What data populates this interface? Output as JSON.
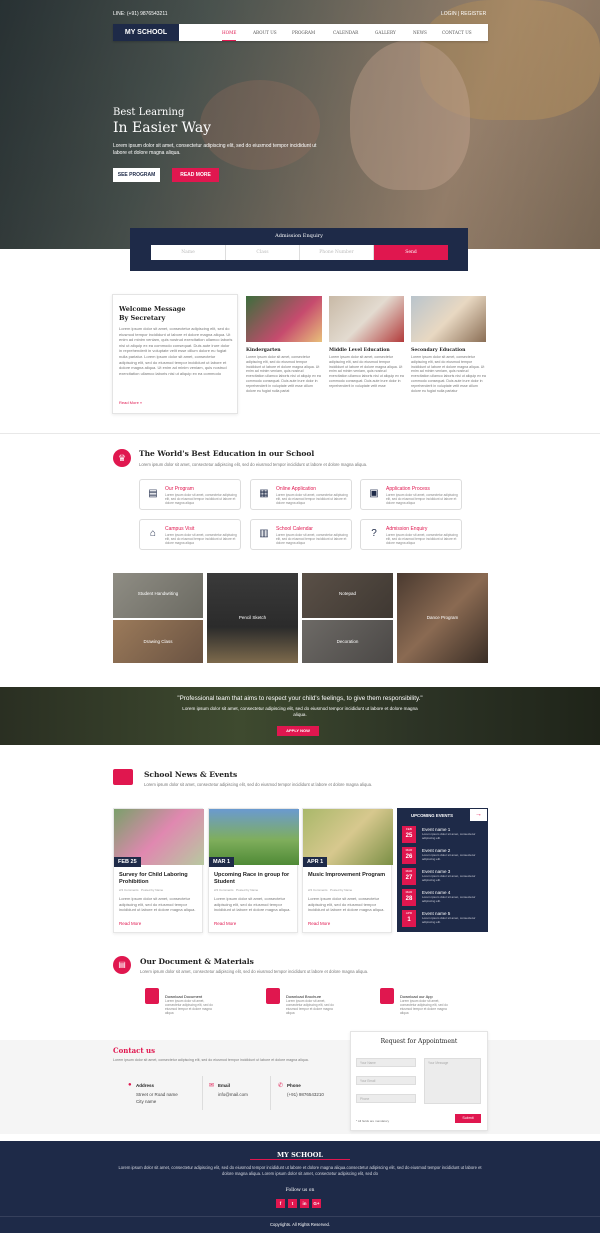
{
  "topbar": {
    "phone": "LINE: (+91) 9876543211",
    "auth": "LOGIN | REGISTER"
  },
  "nav": {
    "logo": "MY SCHOOL",
    "items": [
      "HOME",
      "ABOUT US",
      "PROGRAM",
      "CALENDAR",
      "GALLERY",
      "NEWS",
      "CONTACT US"
    ],
    "active": "HOME"
  },
  "hero": {
    "line1": "Best Learning",
    "line2": "In Easier Way",
    "text": "Lorem ipsum dolor sit amet, consectetur adipiscing elit, sed do eiusmod tempor incididunt ut labore et dolore magna aliqua.",
    "btn1": "SEE PROGRAM",
    "btn2": "READ MORE"
  },
  "enquiry": {
    "title": "Admission Enquiry",
    "name": "Name",
    "class": "Class",
    "phone": "Phone Number",
    "send": "Send"
  },
  "welcome": {
    "title1": "Welcome Message",
    "title2": "By Secretary",
    "text": "Lorem ipsum dolor sit amet, consectetur adipiscing elit, sed do eiusmod tempor incididunt ut labore et dolore magna aliqua. Ut enim ad minim veniam, quis nostrud exercitation ullamco laboris nisi ut aliquip ex ea commodo consequat. Duis aute irure dolor in reprehenderit in voluptate velit esse cillum dolore eu fugiat nulla pariatur. Lorem ipsum dolor sit amet, consectetur adipiscing elit, sed do eiusmod tempor incididunt ut labore et dolore magna aliqua. Ut enim ad minim veniam, quis nostrud exercitation ullamco laboris nisi ut aliquip ex ea commodo",
    "link": "Read More »"
  },
  "levels": [
    {
      "title": "Kindergarten",
      "text": "Lorem ipsum dolor sit amet, consectetur adipiscing elit, sed do eiusmod tempor incididunt ut labore et dolore magna aliqua. Ut enim ad minim veniam, quis nostrud exercitation ullamco laboris nisi ut aliquip ex ea commodo consequat. Duis aute irure dolor in reprehenderit in voluptate velit esse cillum dolore eu fugiat nulla pariat"
    },
    {
      "title": "Middle Level Education",
      "text": "Lorem ipsum dolor sit amet, consectetur adipiscing elit, sed do eiusmod tempor incididunt ut labore et dolore magna aliqua. Ut enim ad minim veniam, quis nostrud exercitation ullamco laboris nisi ut aliquip ex ea commodo consequat. Duis aute irure dolor in reprehenderit in voluptate velit esse"
    },
    {
      "title": "Secondary Education",
      "text": "Lorem ipsum dolor sit amet, consectetur adipiscing elit, sed do eiusmod tempor incididunt ut labore et dolore magna aliqua. Ut enim ad minim veniam, quis nostrud exercitation ullamco laboris nisi ut aliquip ex ea commodo consequat. Duis aute irure dolor in reprehenderit in voluptate velit esse cillum dolore eu fugiat nulla pariatur"
    }
  ],
  "world": {
    "title": "The World's Best Education in our School",
    "text": "Lorem ipsum dolor sit amet, consectetur adipiscing elit, sed do eiusmod tempor incididunt ut labore et dolore magna aliqua."
  },
  "features": [
    {
      "title": "Our Program",
      "text": "Lorem ipsum dolor sit amet, consectetur adipiscing elit, sed do eiusmod tempor incididunt ut labore et dolore magna aliqua"
    },
    {
      "title": "Online Application",
      "text": "Lorem ipsum dolor sit amet, consectetur adipiscing elit, sed do eiusmod tempor incididunt ut labore et dolore magna aliqua"
    },
    {
      "title": "Application Process",
      "text": "Lorem ipsum dolor sit amet, consectetur adipiscing elit, sed do eiusmod tempor incididunt ut labore et dolore magna aliqua"
    },
    {
      "title": "Campus Visit",
      "text": "Lorem ipsum dolor sit amet, consectetur adipiscing elit, sed do eiusmod tempor incididunt ut labore et dolore magna aliqua"
    },
    {
      "title": "School Calendar",
      "text": "Lorem ipsum dolor sit amet, consectetur adipiscing elit, sed do eiusmod tempor incididunt ut labore et dolore magna aliqua"
    },
    {
      "title": "Admission Enquiry",
      "text": "Lorem ipsum dolor sit amet, consectetur adipiscing elit, sed do eiusmod tempor incididunt ut labore et dolore magna aliqua"
    }
  ],
  "gallery": [
    "Student Handwriting",
    "Drawing Class",
    "Pencil Sketch",
    "Notepad",
    "Decoration",
    "Dance Program"
  ],
  "quote": {
    "text": "\"Professional team that aims to respect your child's feelings, to give them responsibility.\"",
    "sub": "Lorem ipsum dolor sit amet, consectetur adipiscing elit, sed do eiusmod tempor incididunt ut labore et dolore magna aliqua.",
    "btn": "APPLY NOW"
  },
  "newsSection": {
    "title": "School News & Events",
    "text": "Lorem ipsum dolor sit amet, consectetur adipiscing elit, sed do eiusmod tempor incididunt ut labore et dolore magna aliqua."
  },
  "news": [
    {
      "date": "FEB 25",
      "title": "Survey for Child Laboring Prohibition",
      "comments": "2/4 Comments",
      "by": "Posted by Name",
      "text": "Lorem ipsum dolor sit amet, consectetur adipiscing elit, sed do eiusmod tempor incididunt ut labore et dolore magna aliqua.",
      "more": "Read More"
    },
    {
      "date": "MAR 1",
      "title": "Upcoming Race in group for Student",
      "comments": "2/4 Comments",
      "by": "Posted by Name",
      "text": "Lorem ipsum dolor sit amet, consectetur adipiscing elit, sed do eiusmod tempor incididunt ut labore et dolore magna aliqua.",
      "more": "Read More"
    },
    {
      "date": "APR 1",
      "title": "Music Improvement Program",
      "comments": "2/4 Comments",
      "by": "Posted by Name",
      "text": "Lorem ipsum dolor sit amet, consectetur adipiscing elit, sed do eiusmod tempor incididunt ut labore et dolore magna aliqua.",
      "more": "Read More"
    }
  ],
  "events": {
    "title": "UPCOMING EVENTS",
    "items": [
      {
        "m": "FEB",
        "d": "25",
        "name": "Event name 1",
        "text": "Lorem ipsum dolor sit amet, consectetur adipiscing elit."
      },
      {
        "m": "MAR",
        "d": "26",
        "name": "Event name 2",
        "text": "Lorem ipsum dolor sit amet, consectetur adipiscing elit."
      },
      {
        "m": "MAR",
        "d": "27",
        "name": "Event name 3",
        "text": "Lorem ipsum dolor sit amet, consectetur adipiscing elit."
      },
      {
        "m": "MAR",
        "d": "28",
        "name": "Event name 4",
        "text": "Lorem ipsum dolor sit amet, consectetur adipiscing elit."
      },
      {
        "m": "APR",
        "d": "1",
        "name": "Event name 5",
        "text": "Lorem ipsum dolor sit amet, consectetur adipiscing elit."
      }
    ]
  },
  "docs": {
    "title": "Our Document & Materials",
    "text": "Lorem ipsum dolor sit amet, consectetur adipiscing elit, sed do eiusmod tempor incididunt ut labore et dolore magna aliqua.",
    "items": [
      {
        "title": "Download Document",
        "text": "Lorem ipsum dolor sit amet, consectetur adipiscing elit, sed do eiusmod tempor et dolore magna aliqua"
      },
      {
        "title": "Download Brochure",
        "text": "Lorem ipsum dolor sit amet, consectetur adipiscing elit, sed do eiusmod tempor et dolore magna aliqua"
      },
      {
        "title": "Download our App",
        "text": "Lorem ipsum dolor sit amet, consectetur adipiscing elit, sed do eiusmod tempor et dolore magna aliqua"
      }
    ]
  },
  "contact": {
    "title": "Contact us",
    "text": "Lorem ipsum dolor sit amet, consectetur adipiscing elit, sed do eiusmod tempor incididunt ut labore et dolore magna aliqua.",
    "addrLabel": "Address",
    "addr1": "Street or Road name",
    "addr2": "City name",
    "emailLabel": "Email",
    "email": "info@mail.com",
    "phoneLabel": "Phone",
    "phone": "(+91) 9876543210"
  },
  "appointment": {
    "title": "Request for Appointment",
    "name": "Your Name",
    "email": "Your Email",
    "phone": "Phone",
    "message": "Your Message",
    "note": "* All fields are mandatory",
    "submit": "Submit"
  },
  "footer": {
    "title": "MY SCHOOL",
    "text": "Lorem ipsum dolor sit amet, consectetur adipiscing elit, sed do eiusmod tempor incididunt ut labore et dolore magna aliqua.consectetur adipiscing elit, sed do eiusmod tempor incididunt ut labore et dolore magna aliqua. Lorem ipsum dolor sit amet, consectetur adipiscing elit, sed do",
    "follow": "Follow us on",
    "social": [
      "f",
      "t",
      "in",
      "G+"
    ],
    "copy": "Copyrights. All Rights Reserved."
  },
  "colors": {
    "navy": "#1e2a48",
    "accent": "#e0174f"
  }
}
